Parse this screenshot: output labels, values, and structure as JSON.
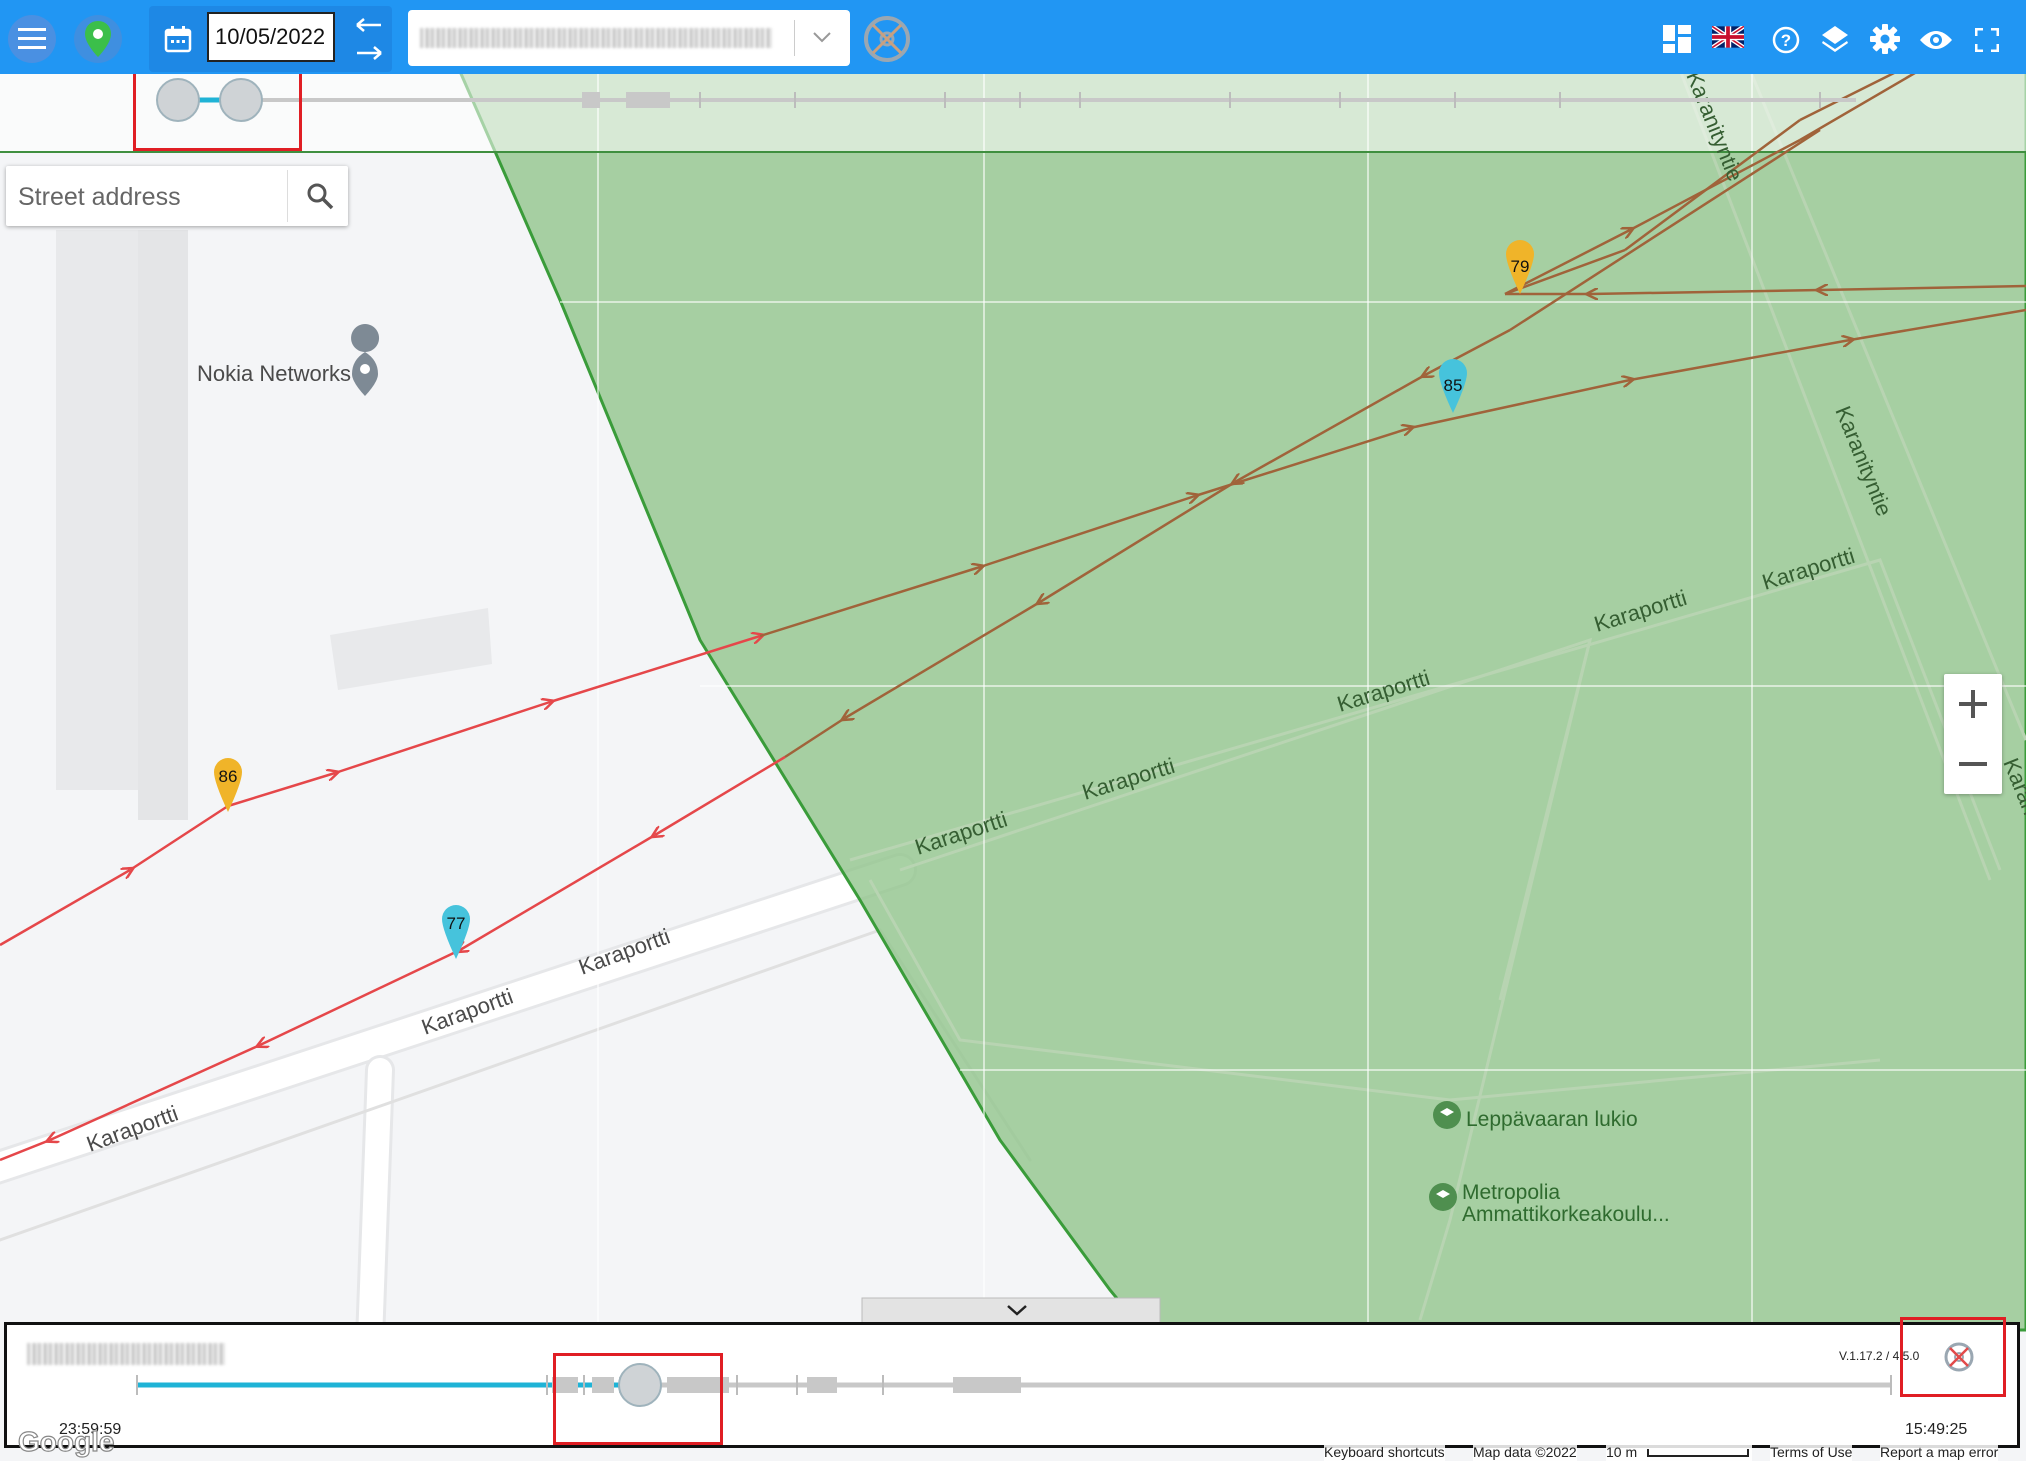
{
  "toolbar": {
    "date_value": "10/05/2022",
    "device_select_placeholder": "",
    "icons": [
      "menu-icon",
      "location-pin-icon",
      "calendar-icon",
      "arrow-left-icon",
      "arrow-right-icon",
      "chevron-down-icon",
      "steering-wheel-icon",
      "dashboard-layout-icon",
      "uk-flag-icon",
      "help-icon",
      "layers-icon",
      "settings-icon",
      "visibility-icon",
      "fullscreen-icon"
    ]
  },
  "search": {
    "placeholder": "Street address"
  },
  "map": {
    "places": [
      {
        "name": "Nokia Networks",
        "type": "poi-pin"
      },
      {
        "name": "Leppävaaran lukio",
        "type": "school"
      },
      {
        "name": "Metropolia Ammattikorkeakoulu...",
        "line1": "Metropolia",
        "line2": "Ammattikorkeakoulu..."
      }
    ],
    "streets": [
      "Karaportti",
      "Karaportti",
      "Karaportti",
      "Karaportti",
      "Karaportti",
      "Karaportti",
      "Karaportti",
      "Karaportti",
      "Karaportti",
      "Karanityntie",
      "Karanityntie",
      "Karan..."
    ],
    "markers": [
      {
        "label": "79",
        "color": "#f0b429"
      },
      {
        "label": "85",
        "color": "#46c3dc"
      },
      {
        "label": "86",
        "color": "#f0b429"
      },
      {
        "label": "77",
        "color": "#46c3dc"
      }
    ],
    "route_colors": {
      "red": "#e5474a",
      "brown": "#a0633a"
    },
    "geofence_color": "#8fc48a"
  },
  "timeline": {
    "start_time": "23:59:59",
    "end_time": "15:49:25",
    "version": "V.1.17.2 / 4.5.0",
    "progress_color": "#1fb3d6"
  },
  "attribution": {
    "logo": "Google",
    "keyboard": "Keyboard shortcuts",
    "mapdata": "Map data ©2022",
    "scale": "10 m",
    "terms": "Terms of Use",
    "report": "Report a map error"
  }
}
